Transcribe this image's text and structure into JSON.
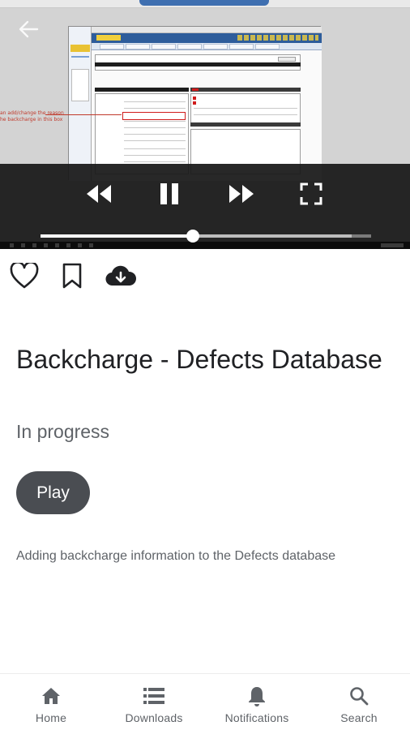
{
  "video": {
    "annotation_line1": "an add/change the reason",
    "annotation_line2": "he backcharge in this box",
    "progress_fraction": 0.46,
    "buffered_fraction": 0.94,
    "controls": [
      "rewind-icon",
      "pause-icon",
      "fast-forward-icon",
      "fullscreen-icon"
    ]
  },
  "actions": {
    "icons": [
      "heart-icon",
      "bookmark-icon",
      "cloud-download-icon"
    ]
  },
  "content": {
    "title": "Backcharge - Defects Database",
    "status": "In progress",
    "play_label": "Play",
    "description": "Adding backcharge information to the Defects database"
  },
  "bottom_nav": [
    {
      "label": "Home",
      "icon": "home-icon"
    },
    {
      "label": "Downloads",
      "icon": "list-icon"
    },
    {
      "label": "Notifications",
      "icon": "bell-icon"
    },
    {
      "label": "Search",
      "icon": "search-icon"
    }
  ],
  "colors": {
    "play_button": "#4a4d52",
    "overlay": "#181818",
    "text_primary": "#202124",
    "text_secondary": "#5f6368"
  }
}
